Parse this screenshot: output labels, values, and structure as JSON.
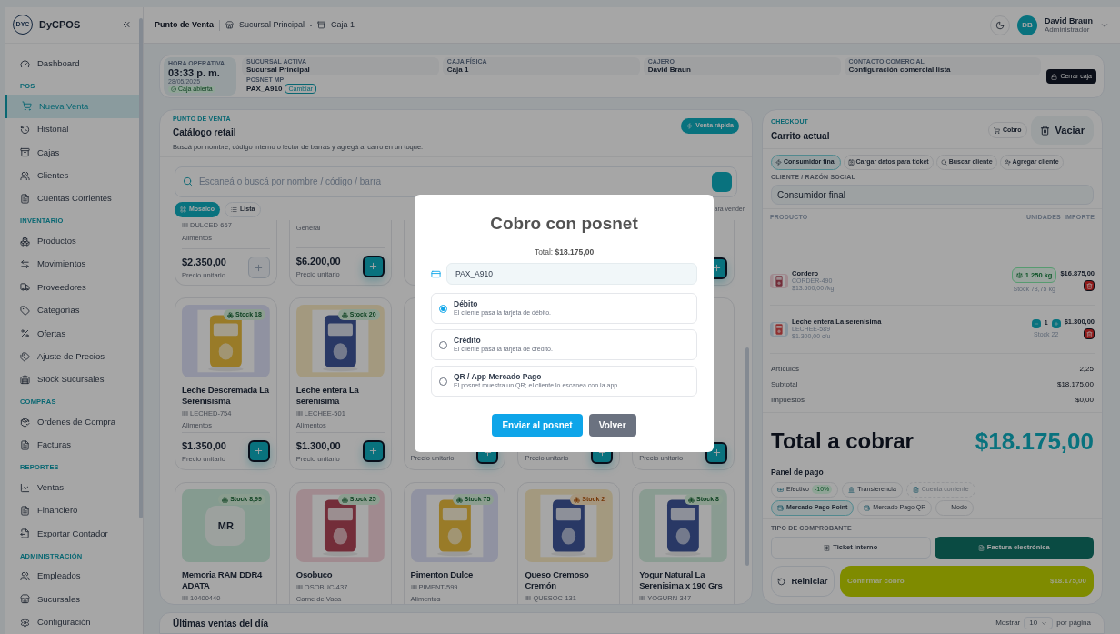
{
  "sidebar": {
    "logo": "DYC",
    "brand": "DyCPOS",
    "groups": [
      {
        "items": [
          {
            "label": "Dashboard",
            "selected": false
          }
        ]
      },
      {
        "title": "POS",
        "items": [
          {
            "label": "Nueva Venta",
            "selected": true
          },
          {
            "label": "Historial",
            "selected": false
          },
          {
            "label": "Cajas",
            "selected": false
          },
          {
            "label": "Clientes",
            "selected": false
          },
          {
            "label": "Cuentas Corrientes",
            "selected": false
          }
        ]
      },
      {
        "title": "INVENTARIO",
        "items": [
          {
            "label": "Productos",
            "selected": false
          },
          {
            "label": "Movimientos",
            "selected": false
          },
          {
            "label": "Proveedores",
            "selected": false
          },
          {
            "label": "Categorías",
            "selected": false
          },
          {
            "label": "Ofertas",
            "selected": false
          },
          {
            "label": "Ajuste de Precios",
            "selected": false
          },
          {
            "label": "Stock Sucursales",
            "selected": false
          }
        ]
      },
      {
        "title": "COMPRAS",
        "items": [
          {
            "label": "Órdenes de Compra",
            "selected": false
          },
          {
            "label": "Facturas",
            "selected": false
          }
        ]
      },
      {
        "title": "REPORTES",
        "items": [
          {
            "label": "Ventas",
            "selected": false
          },
          {
            "label": "Financiero",
            "selected": false
          },
          {
            "label": "Exportar Contador",
            "selected": false
          }
        ]
      },
      {
        "title": "ADMINISTRACIÓN",
        "items": [
          {
            "label": "Empleados",
            "selected": false
          },
          {
            "label": "Sucursales",
            "selected": false
          },
          {
            "label": "Configuración",
            "selected": false
          }
        ]
      }
    ]
  },
  "header": {
    "breadcrumb": [
      "Punto de Venta",
      "Sucursal Principal",
      "Caja 1"
    ],
    "user": {
      "initials": "DB",
      "name": "David Braun",
      "role": "Administrador"
    }
  },
  "info": {
    "hour": {
      "label": "HORA OPERATIVA",
      "time": "03:33 p. m.",
      "date": "28/05/2025",
      "status": "Caja abierta"
    },
    "fields": [
      {
        "label": "SUCURSAL ACTIVA",
        "value": "Sucursal Principal"
      },
      {
        "label": "CAJA FÍSICA",
        "value": "Caja 1"
      },
      {
        "label": "CAJERO",
        "value": "David Braun"
      },
      {
        "label": "CONTACTO COMERCIAL",
        "value": "Configuración comercial lista"
      }
    ],
    "posnet": {
      "label": "POSNET MP",
      "value": "PAX_A910",
      "action": "Cambiar"
    },
    "close_button": "Cerrar caja"
  },
  "catalog": {
    "eyebrow": "PUNTO DE VENTA",
    "title": "Catálogo retail",
    "subtitle": "Buscá por nombre, código interno o lector de barras y agregá al carro en un toque.",
    "quick_sale": "Venta rápida",
    "search": {
      "placeholder": "Escaneá o buscá por nombre / código / barra"
    },
    "views": [
      {
        "label": "Mosaico",
        "selected": true
      },
      {
        "label": "Lista",
        "selected": false
      }
    ],
    "hint": "ara vender",
    "products": [
      {
        "kind": "partial",
        "code": "DULCED-667",
        "category": "Alimentos",
        "price": "$2.350,00",
        "price_label": "Precio unitario",
        "add_disabled": true
      },
      {
        "kind": "partial",
        "category": "General",
        "price": "$6.200,00",
        "price_label": "Precio unitario",
        "add_disabled": false
      },
      {
        "kind": "covered"
      },
      {
        "kind": "covered",
        "add_disabled": false
      },
      {
        "kind": "card",
        "stock": "Stock 18",
        "low_stock": false,
        "title": "Leche Descremada La Serenisisma",
        "code": "LECHED-754",
        "category": "Alimentos",
        "price": "$1.350,00",
        "price_label": "Precio unitario",
        "add_disabled": false
      },
      {
        "kind": "card",
        "stock": "Stock 20",
        "low_stock": false,
        "title": "Leche entera La serenisima",
        "code": "LECHEE-501",
        "category": "Alimentos",
        "price": "$1.300,00",
        "price_label": "Precio unitario",
        "add_disabled": false
      },
      {
        "kind": "covered",
        "price_label": "Precio unitario",
        "add_disabled": false
      },
      {
        "kind": "covered",
        "price_label": "Precio unitario",
        "add_disabled": false
      },
      {
        "kind": "covered",
        "price_label": "Precio unitario",
        "add_disabled": false
      },
      {
        "kind": "card",
        "image": {
          "kind": "initials",
          "text": "MR"
        },
        "stock": "Stock 8,99",
        "low_stock": false,
        "title": "Memoria RAM DDR4 ADATA",
        "code": "10400440"
      },
      {
        "kind": "card",
        "stock": "Stock 25",
        "low_stock": false,
        "title": "Osobuco",
        "code": "OSOBUC-437",
        "category": "Carne de Vaca"
      },
      {
        "kind": "card",
        "stock": "Stock 75",
        "low_stock": false,
        "title": "Pimenton Dulce",
        "code": "PIMENT-599",
        "category": "Alimentos"
      },
      {
        "kind": "card",
        "stock": "Stock 2",
        "low_stock": true,
        "title": "Queso Cremoso Cremón",
        "code": "QUESOC-131"
      },
      {
        "kind": "card",
        "stock": "Stock 8",
        "low_stock": false,
        "title": "Yogur Natural La Serenisima x 190 Grs",
        "code": "YOGURN-347"
      }
    ]
  },
  "checkout": {
    "eyebrow": "CHECKOUT",
    "title": "Carrito actual",
    "cobro": "Cobro",
    "clear": "Vaciar",
    "customer_modes": [
      {
        "label": "Consumidor final",
        "selected": true
      },
      {
        "label": "Cargar datos para ticket",
        "selected": false
      },
      {
        "label": "Buscar cliente",
        "selected": false
      },
      {
        "label": "Agregar cliente",
        "selected": false
      }
    ],
    "customer_label": "CLIENTE / RAZÓN SOCIAL",
    "customer_value": "Consumidor final",
    "columns": [
      "PRODUCTO",
      "UNIDADES",
      "IMPORTE"
    ],
    "items": [
      {
        "kind": "weight",
        "name": "Cordero",
        "code": "CORDER-490",
        "unit_price": "$13.500,00 /kg",
        "quantity": "1.250 kg",
        "stock": "Stock 78,75 kg",
        "amount": "$16.875,00"
      },
      {
        "kind": "unit",
        "name": "Leche entera La serenisima",
        "code": "LECHEE-589",
        "unit_price": "$1.300,00 c/u",
        "quantity": "1",
        "stock": "Stock 22",
        "amount": "$1.300,00"
      }
    ],
    "summary": [
      {
        "label": "Artículos",
        "value": "2,25"
      },
      {
        "label": "Subtotal",
        "value": "$18.175,00"
      },
      {
        "label": "Impuestos",
        "value": "$0,00"
      }
    ],
    "total_label": "Total a cobrar",
    "total": "$18.175,00",
    "payment_title": "Panel de pago",
    "payments": [
      {
        "label": "Efectivo",
        "badge": "-10%",
        "selected": false,
        "disabled": false
      },
      {
        "label": "Transferencia",
        "selected": false,
        "disabled": false
      },
      {
        "label": "Cuenta corriente",
        "selected": false,
        "disabled": true
      },
      {
        "label": "Mercado Pago Point",
        "selected": true,
        "disabled": false
      },
      {
        "label": "Mercado Pago QR",
        "selected": false,
        "disabled": false
      },
      {
        "label": "Modo",
        "selected": false,
        "disabled": false
      }
    ],
    "receipt_label": "TIPO DE COMPROBANTE",
    "receipts": [
      {
        "label": "Ticket interno",
        "selected": false
      },
      {
        "label": "Factura electrónica",
        "selected": true
      }
    ],
    "reset": "Reiniciar",
    "confirm": {
      "label": "Confirmar cobro",
      "amount": "$18.175,00"
    }
  },
  "sales": {
    "title": "Últimas ventas del día",
    "show": "Mostrar",
    "page_size": "10",
    "per_page": "por página"
  },
  "modal": {
    "title": "Cobro con posnet",
    "total": "Total: **$18.175,00**",
    "device": "PAX_A910",
    "options": [
      {
        "label": "Débito",
        "description": "El cliente pasa la tarjeta de débito.",
        "selected": true
      },
      {
        "label": "Crédito",
        "description": "El cliente pasa la tarjeta de crédito.",
        "selected": false
      },
      {
        "label": "QR / App Mercado Pago",
        "description": "El posnet muestra un QR; el cliente lo escanea con la app.",
        "selected": false
      }
    ],
    "buttons": [
      {
        "label": "Enviar al posnet",
        "kind": "primary"
      },
      {
        "label": "Volver",
        "kind": "secondary"
      }
    ]
  }
}
